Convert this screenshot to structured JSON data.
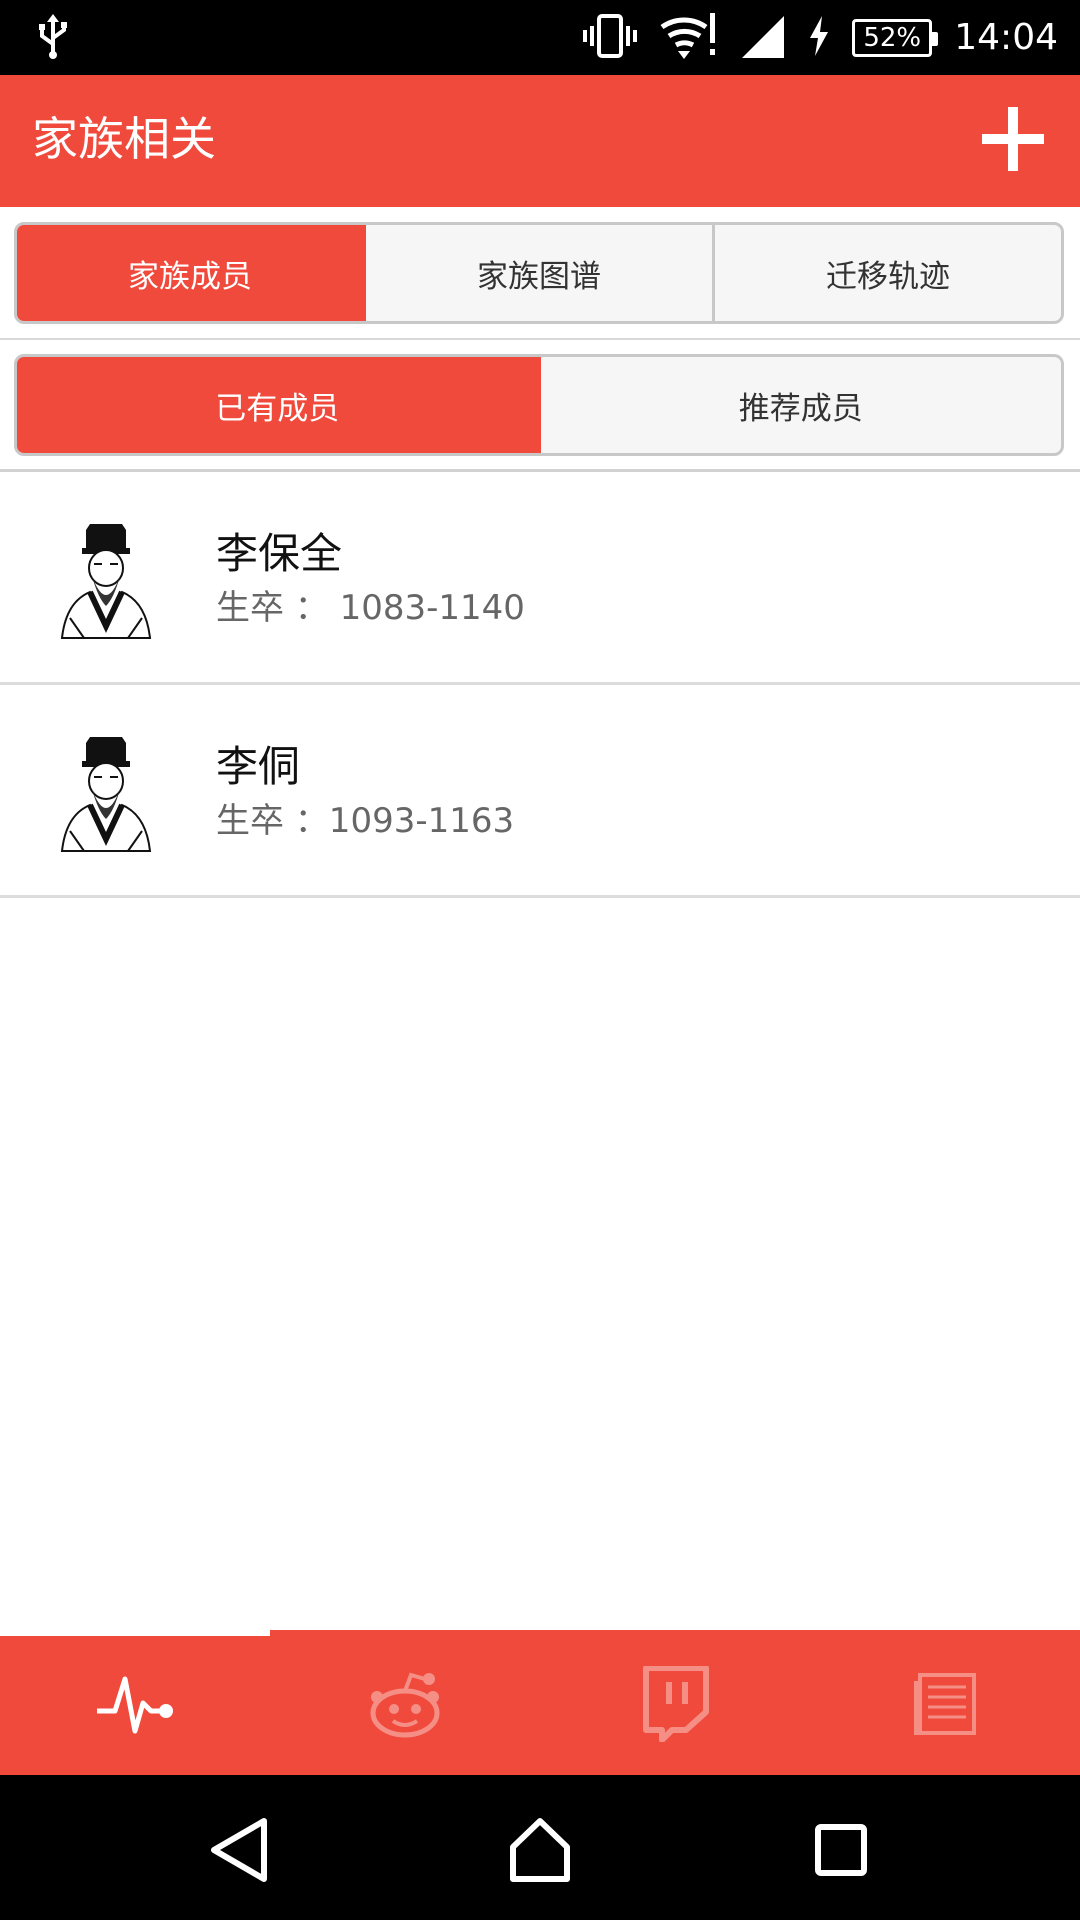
{
  "status_bar": {
    "battery": "52%",
    "time": "14:04",
    "icons": [
      "usb-icon",
      "vibrate-icon",
      "wifi-icon",
      "signal-icon",
      "charging-icon",
      "battery-icon"
    ]
  },
  "app_bar": {
    "title": "家族相关",
    "add_icon": "plus-icon"
  },
  "top_tabs": [
    {
      "label": "家族成员",
      "active": true
    },
    {
      "label": "家族图谱",
      "active": false
    },
    {
      "label": "迁移轨迹",
      "active": false
    }
  ],
  "sub_tabs": [
    {
      "label": "已有成员",
      "active": true
    },
    {
      "label": "推荐成员",
      "active": false
    }
  ],
  "members": [
    {
      "name": "李保全",
      "dates": "生卒 ： 1083-1140"
    },
    {
      "name": "李侗",
      "dates": "生卒 ：1093-1163"
    }
  ],
  "bottom_nav": {
    "items": [
      "pulse-icon",
      "reddit-icon",
      "twitch-icon",
      "document-icon"
    ],
    "active_index": 0
  },
  "colors": {
    "accent": "#f04a3d",
    "nav_inactive_icon": "#f58f86"
  }
}
